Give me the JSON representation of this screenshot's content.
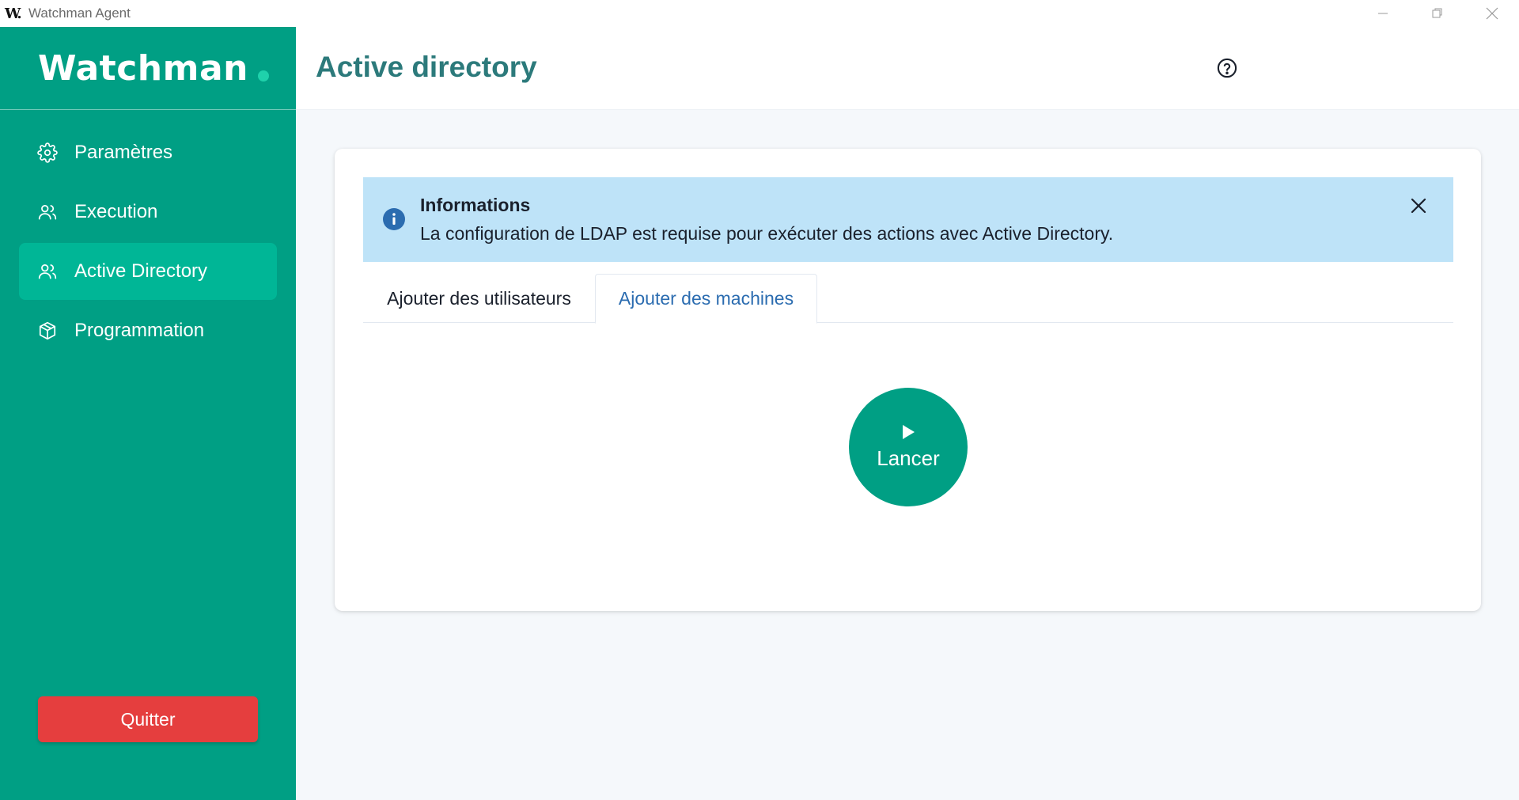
{
  "window": {
    "logo_mark": "W.",
    "title": "Watchman Agent"
  },
  "sidebar": {
    "brand": "Watchman",
    "items": [
      {
        "label": "Paramètres",
        "icon": "gear-icon",
        "active": false
      },
      {
        "label": "Execution",
        "icon": "users-icon",
        "active": false
      },
      {
        "label": "Active Directory",
        "icon": "users-icon",
        "active": true
      },
      {
        "label": "Programmation",
        "icon": "package-icon",
        "active": false
      }
    ],
    "quit_label": "Quitter"
  },
  "header": {
    "title": "Active directory",
    "help_icon": "help-circle-icon"
  },
  "alert": {
    "title": "Informations",
    "description": "La configuration de LDAP est requise pour exécuter des actions avec Active Directory.",
    "icon": "info-icon"
  },
  "tabs": [
    {
      "label": "Ajouter des utilisateurs",
      "active": false
    },
    {
      "label": "Ajouter des machines",
      "active": true
    }
  ],
  "action": {
    "launch_label": "Lancer",
    "icon": "play-icon"
  },
  "colors": {
    "sidebar": "#009f84",
    "sidebar_active": "#00b696",
    "title": "#2c7a7b",
    "alert_bg": "#bee3f8",
    "danger": "#e53e3e",
    "tab_active": "#2b6cb0"
  }
}
